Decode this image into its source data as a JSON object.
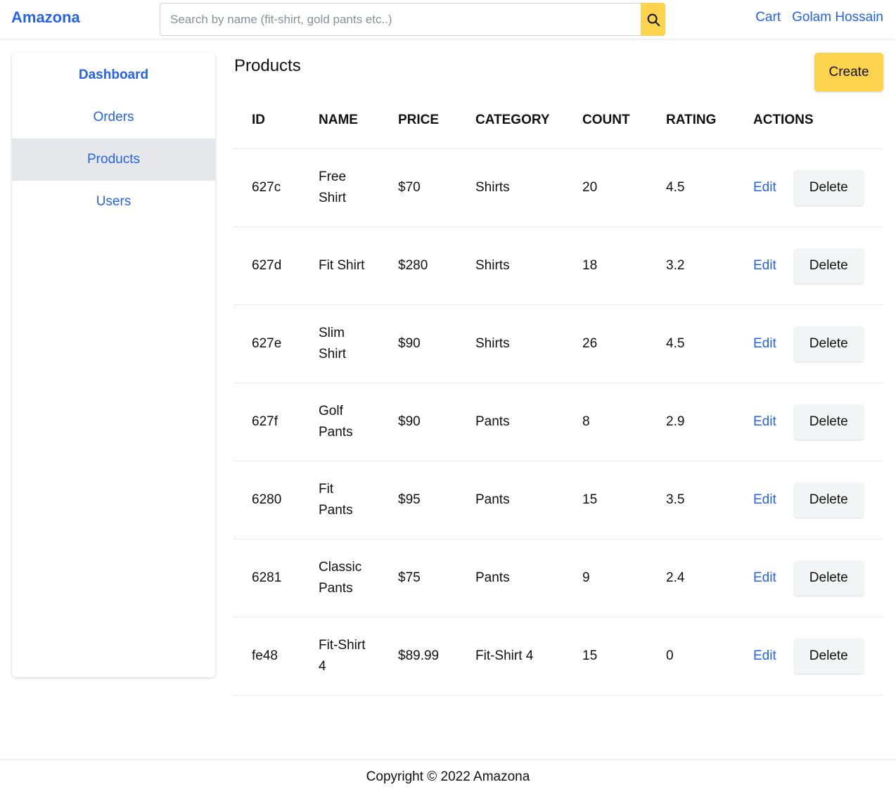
{
  "header": {
    "brand": "Amazona",
    "search_placeholder": "Search by name (fit-shirt, gold pants etc..)",
    "search_icon": "search-icon",
    "cart_label": "Cart",
    "user_label": "Golam Hossain"
  },
  "sidebar": {
    "items": [
      {
        "label": "Dashboard"
      },
      {
        "label": "Orders"
      },
      {
        "label": "Products"
      },
      {
        "label": "Users"
      }
    ]
  },
  "main": {
    "title": "Products",
    "create_label": "Create",
    "columns": [
      "ID",
      "NAME",
      "PRICE",
      "CATEGORY",
      "COUNT",
      "RATING",
      "ACTIONS"
    ],
    "edit_label": "Edit",
    "delete_label": "Delete",
    "rows": [
      {
        "id": "627c",
        "name": "Free Shirt",
        "price": "$70",
        "category": "Shirts",
        "count": "20",
        "rating": "4.5"
      },
      {
        "id": "627d",
        "name": "Fit Shirt",
        "price": "$280",
        "category": "Shirts",
        "count": "18",
        "rating": "3.2"
      },
      {
        "id": "627e",
        "name": "Slim Shirt",
        "price": "$90",
        "category": "Shirts",
        "count": "26",
        "rating": "4.5"
      },
      {
        "id": "627f",
        "name": "Golf Pants",
        "price": "$90",
        "category": "Pants",
        "count": "8",
        "rating": "2.9"
      },
      {
        "id": "6280",
        "name": "Fit Pants",
        "price": "$95",
        "category": "Pants",
        "count": "15",
        "rating": "3.5"
      },
      {
        "id": "6281",
        "name": "Classic Pants",
        "price": "$75",
        "category": "Pants",
        "count": "9",
        "rating": "2.4"
      },
      {
        "id": "fe48",
        "name": "Fit-Shirt 4",
        "price": "$89.99",
        "category": "Fit-Shirt 4",
        "count": "15",
        "rating": "0"
      }
    ]
  },
  "footer": {
    "copyright": "Copyright © 2022 Amazona"
  },
  "colors": {
    "accent": "#2563eb",
    "button_yellow": "#fcd34d",
    "active_bg": "#e5e7eb"
  }
}
